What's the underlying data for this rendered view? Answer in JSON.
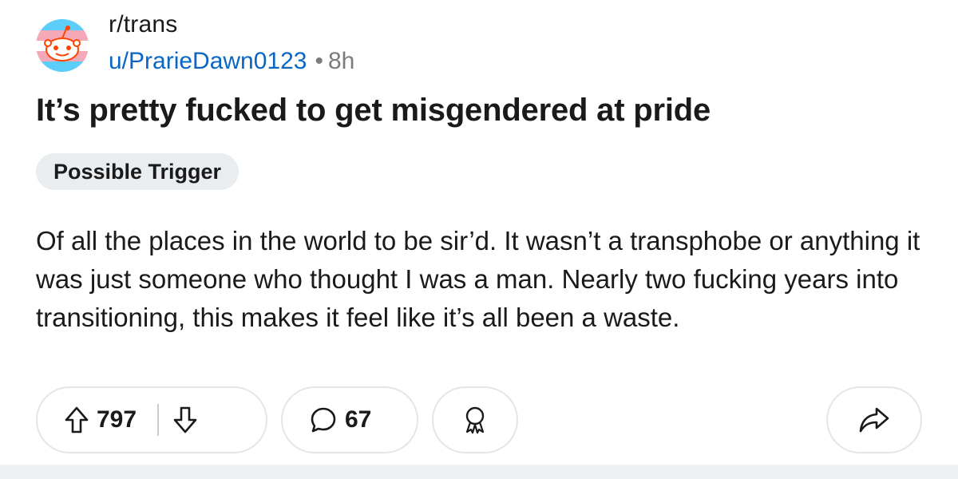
{
  "post": {
    "subreddit": "r/trans",
    "author": "u/PrarieDawn0123",
    "separator": "•",
    "age": "8h",
    "title": "It’s pretty fucked to get misgendered at pride",
    "flair": "Possible Trigger",
    "body": "Of all the places in the world to be sir’d. It wasn’t a transphobe or anything it was just someone who thought I was a man. Nearly two fucking years into transitioning, this makes it feel like it’s all been a waste."
  },
  "actions": {
    "upvotes": "797",
    "comments": "67",
    "upvote_icon": "arrow-up-icon",
    "downvote_icon": "arrow-down-icon",
    "comment_icon": "speech-bubble-icon",
    "award_icon": "award-ribbon-icon",
    "share_icon": "share-arrow-icon"
  },
  "colors": {
    "author_link": "#0a66c2",
    "flag_blue": "#5bcefa",
    "flag_pink": "#f5a9b8",
    "snoo_orange": "#ff4500"
  }
}
